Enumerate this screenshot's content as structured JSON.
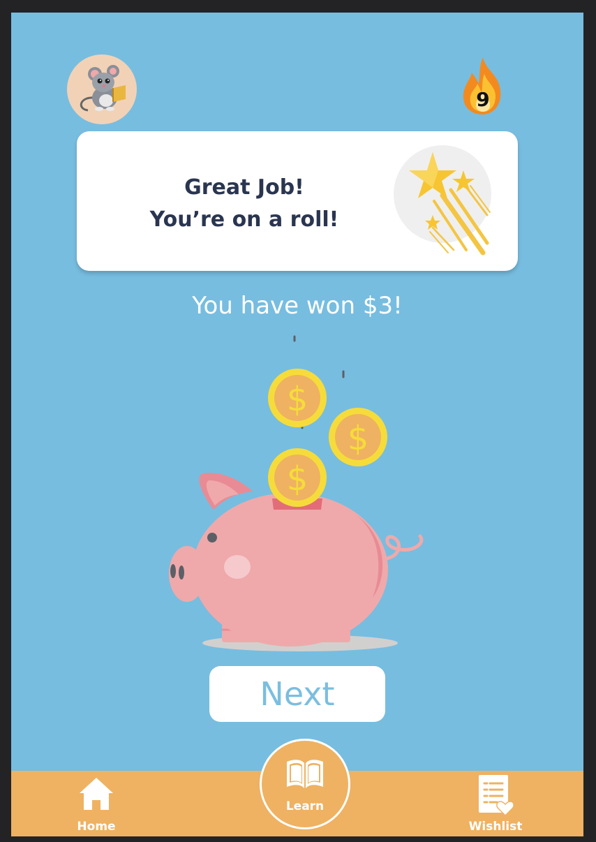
{
  "header": {
    "avatar_icon": "mouse-reading-icon",
    "streak_icon": "fire-icon",
    "streak_count": "9"
  },
  "card": {
    "line1": "Great Job!",
    "line2": "You’re on a roll!",
    "icon": "shooting-stars-icon"
  },
  "reward": {
    "message": "You have won $3!",
    "illustration": "piggy-bank-with-coins"
  },
  "actions": {
    "next_label": "Next"
  },
  "bottom_nav": {
    "home_label": "Home",
    "learn_label": "Learn",
    "wishlist_label": "Wishlist"
  },
  "colors": {
    "background": "#77bde0",
    "nav_bar": "#eeb262",
    "card_text": "#2a3550",
    "next_text": "#7bbedf",
    "pig": "#efa9ab",
    "coin": "#f6dc3a"
  }
}
